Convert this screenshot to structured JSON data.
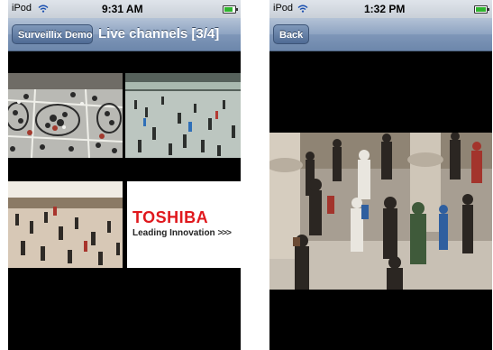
{
  "left_screen": {
    "status_bar": {
      "carrier": "iPod",
      "wifi_icon": "wifi-icon",
      "time": "9:31 AM",
      "battery_icon": "battery-icon",
      "battery_level": 0.8
    },
    "nav": {
      "back_label": "Surveillix Demo",
      "title": "Live channels [3/4]"
    },
    "tiles": [
      {
        "label": "",
        "content": "overhead-crowd-camera-view"
      },
      {
        "label": "",
        "content": "mall-concourse-camera-view"
      },
      {
        "label": "",
        "content": "lobby-crowd-camera-view"
      },
      {
        "label": "Toshiba logo",
        "logo_text": "TOSHIBA",
        "tagline": "Leading Innovation",
        "tagline_mark": ">>>"
      }
    ]
  },
  "right_screen": {
    "status_bar": {
      "carrier": "iPod",
      "wifi_icon": "wifi-icon",
      "time": "1:32 PM",
      "battery_icon": "battery-icon",
      "battery_level": 1.0
    },
    "nav": {
      "back_label": "Back"
    },
    "feed": {
      "content": "crowd-camera-view-fullscreen"
    }
  },
  "colors": {
    "nav_bar": "#7e96b8",
    "toshiba_red": "#e0181d",
    "background": "#000000"
  }
}
